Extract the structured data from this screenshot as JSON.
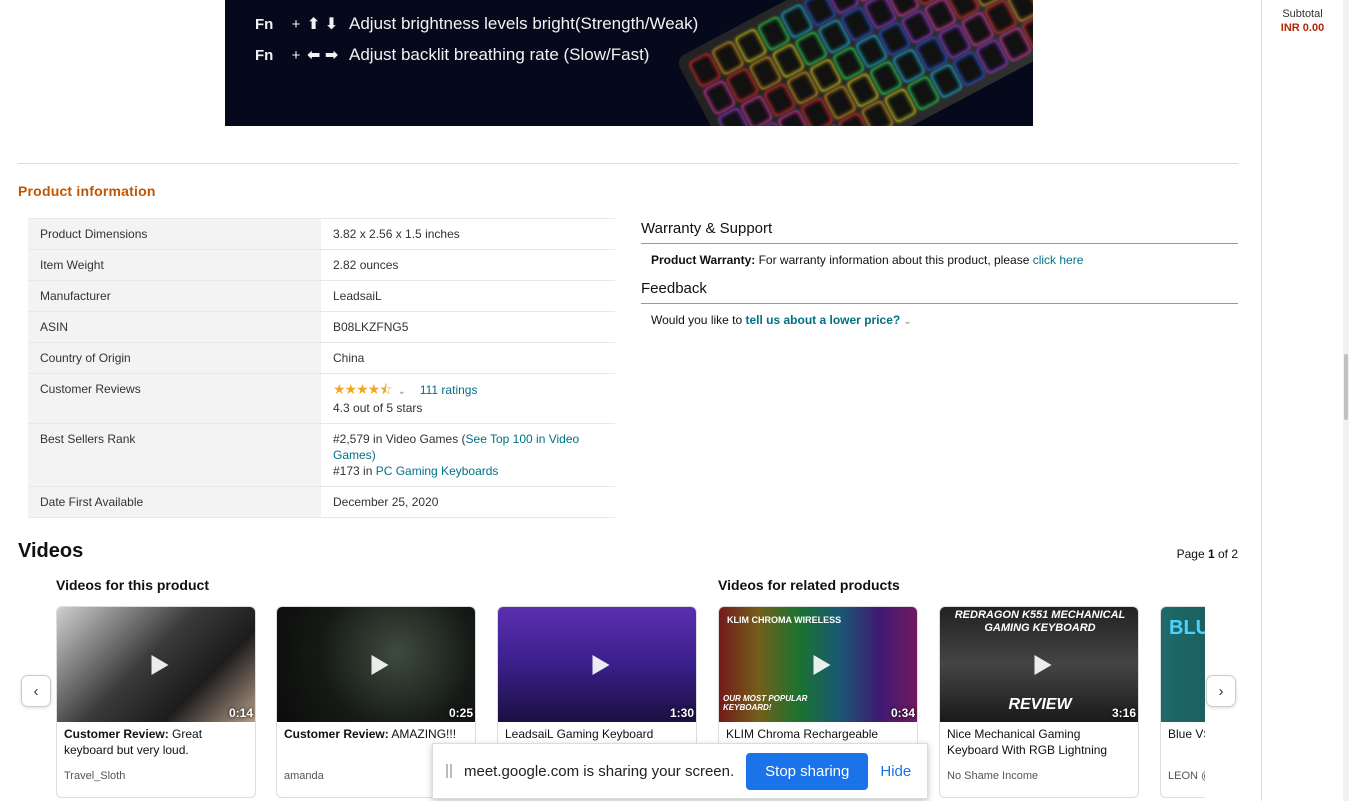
{
  "banner": {
    "row1": {
      "fn": "Fn",
      "plus": "+",
      "arrows": "⬆ ⬇",
      "text": "Adjust brightness levels bright(Strength/Weak)"
    },
    "row2": {
      "fn": "Fn",
      "plus": "+",
      "arrows": "⬅ ➡",
      "text": "Adjust backlit breathing rate (Slow/Fast)"
    }
  },
  "product_info": {
    "title": "Product information",
    "rows": [
      {
        "label": "Product Dimensions",
        "value": "3.82 x 2.56 x 1.5 inches"
      },
      {
        "label": "Item Weight",
        "value": "2.82 ounces"
      },
      {
        "label": "Manufacturer",
        "value": "LeadsaiL"
      },
      {
        "label": "ASIN",
        "value": "B08LKZFNG5"
      },
      {
        "label": "Country of Origin",
        "value": "China"
      }
    ],
    "reviews": {
      "label": "Customer Reviews",
      "stars": "★★★★⯪",
      "ratings_link": "111 ratings",
      "summary": "4.3 out of 5 stars"
    },
    "rank": {
      "label": "Best Sellers Rank",
      "line1_prefix": "#2,579 in Video Games (",
      "line1_link": "See Top 100 in Video Games",
      "line1_suffix": ")",
      "line2_prefix": "#173 in ",
      "line2_link": "PC Gaming Keyboards"
    },
    "date": {
      "label": "Date First Available",
      "value": "December 25, 2020"
    }
  },
  "warranty": {
    "title": "Warranty & Support",
    "label": "Product Warranty:",
    "text": " For warranty information about this product, please ",
    "link": "click here"
  },
  "feedback": {
    "title": "Feedback",
    "text": "Would you like to ",
    "link": "tell us about a lower price?"
  },
  "videos": {
    "title": "Videos",
    "page_prefix": "Page ",
    "page_current": "1",
    "page_suffix": " of 2",
    "this_product_title": "Videos for this product",
    "related_title": "Videos for related products",
    "items": [
      {
        "label": "Customer Review:",
        "title": " Great keyboard but very loud.",
        "author": "Travel_Sloth",
        "duration": "0:14"
      },
      {
        "label": "Customer Review:",
        "title": " AMAZING!!!",
        "author": "amanda",
        "duration": "0:25"
      },
      {
        "label": "",
        "title": "LeadsaiL Gaming Keyboard",
        "author": "",
        "duration": "1:30"
      },
      {
        "label": "",
        "title": "KLIM Chroma Rechargeable",
        "author": "",
        "duration": "0:34",
        "thumb_top": "KLIM CHROMA WIRELESS",
        "thumb_bottom": "OUR MOST POPULAR KEYBOARD!"
      },
      {
        "label": "",
        "title": "Nice Mechanical Gaming Keyboard With RGB Lightning",
        "author": "No Shame Income",
        "duration": "3:16",
        "thumb_top": "REDRAGON K551 MECHANICAL GAMING KEYBOARD",
        "thumb_bottom": "REVIEW"
      },
      {
        "label": "",
        "title": "Blue VS Keyboa",
        "author": "LEON @",
        "duration": "",
        "thumb_top": "BLU"
      }
    ]
  },
  "cart": {
    "subtotal_label": "Subtotal",
    "subtotal_value": "INR 0.00"
  },
  "share_bar": {
    "text": "meet.google.com is sharing your screen.",
    "stop": "Stop sharing",
    "hide": "Hide"
  },
  "colors": {
    "link": "#007185",
    "accent": "#c45500",
    "price": "#b12704",
    "star": "#f5a623",
    "meet_blue": "#1a73e8"
  },
  "icons": {
    "prev": "chevron-left-icon",
    "next": "chevron-right-icon",
    "play": "play-icon"
  }
}
